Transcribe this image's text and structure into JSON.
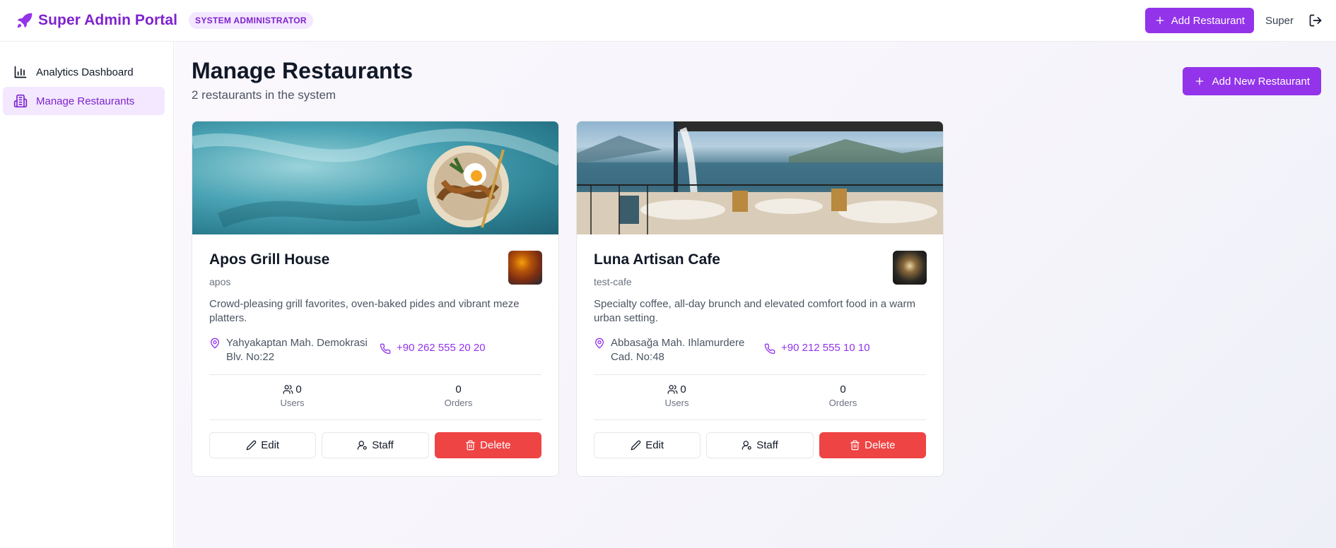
{
  "header": {
    "brand_icon": "rocket-icon",
    "brand_name": "Super Admin Portal",
    "role_badge": "SYSTEM ADMINISTRATOR",
    "add_button": "Add Restaurant",
    "user_name": "Super",
    "logout_icon": "logout-icon"
  },
  "sidebar": {
    "items": [
      {
        "label": "Analytics Dashboard",
        "icon": "bar-chart-icon",
        "active": false
      },
      {
        "label": "Manage Restaurants",
        "icon": "building-icon",
        "active": true
      }
    ]
  },
  "main": {
    "title": "Manage Restaurants",
    "subtitle": "2 restaurants in the system",
    "add_button": "Add New Restaurant"
  },
  "restaurants": [
    {
      "name": "Apos Grill House",
      "slug": "apos",
      "description": "Crowd-pleasing grill favorites, oven-baked pides and vibrant meze platters.",
      "address": "Yahyakaptan Mah. Demokrasi Blv. No:22",
      "phone": "+90 262 555 20 20",
      "users": "0",
      "users_label": "Users",
      "orders": "0",
      "orders_label": "Orders",
      "edit": "Edit",
      "staff": "Staff",
      "delete": "Delete"
    },
    {
      "name": "Luna Artisan Cafe",
      "slug": "test-cafe",
      "description": "Specialty coffee, all-day brunch and elevated comfort food in a warm urban setting.",
      "address": "Abbasağa Mah. Ihlamurdere Cad. No:48",
      "phone": "+90 212 555 10 10",
      "users": "0",
      "users_label": "Users",
      "orders": "0",
      "orders_label": "Orders",
      "edit": "Edit",
      "staff": "Staff",
      "delete": "Delete"
    }
  ],
  "colors": {
    "accent": "#9333ea",
    "accent_text": "#7e22ce",
    "accent_soft": "#f3e8ff",
    "danger": "#ef4444"
  }
}
